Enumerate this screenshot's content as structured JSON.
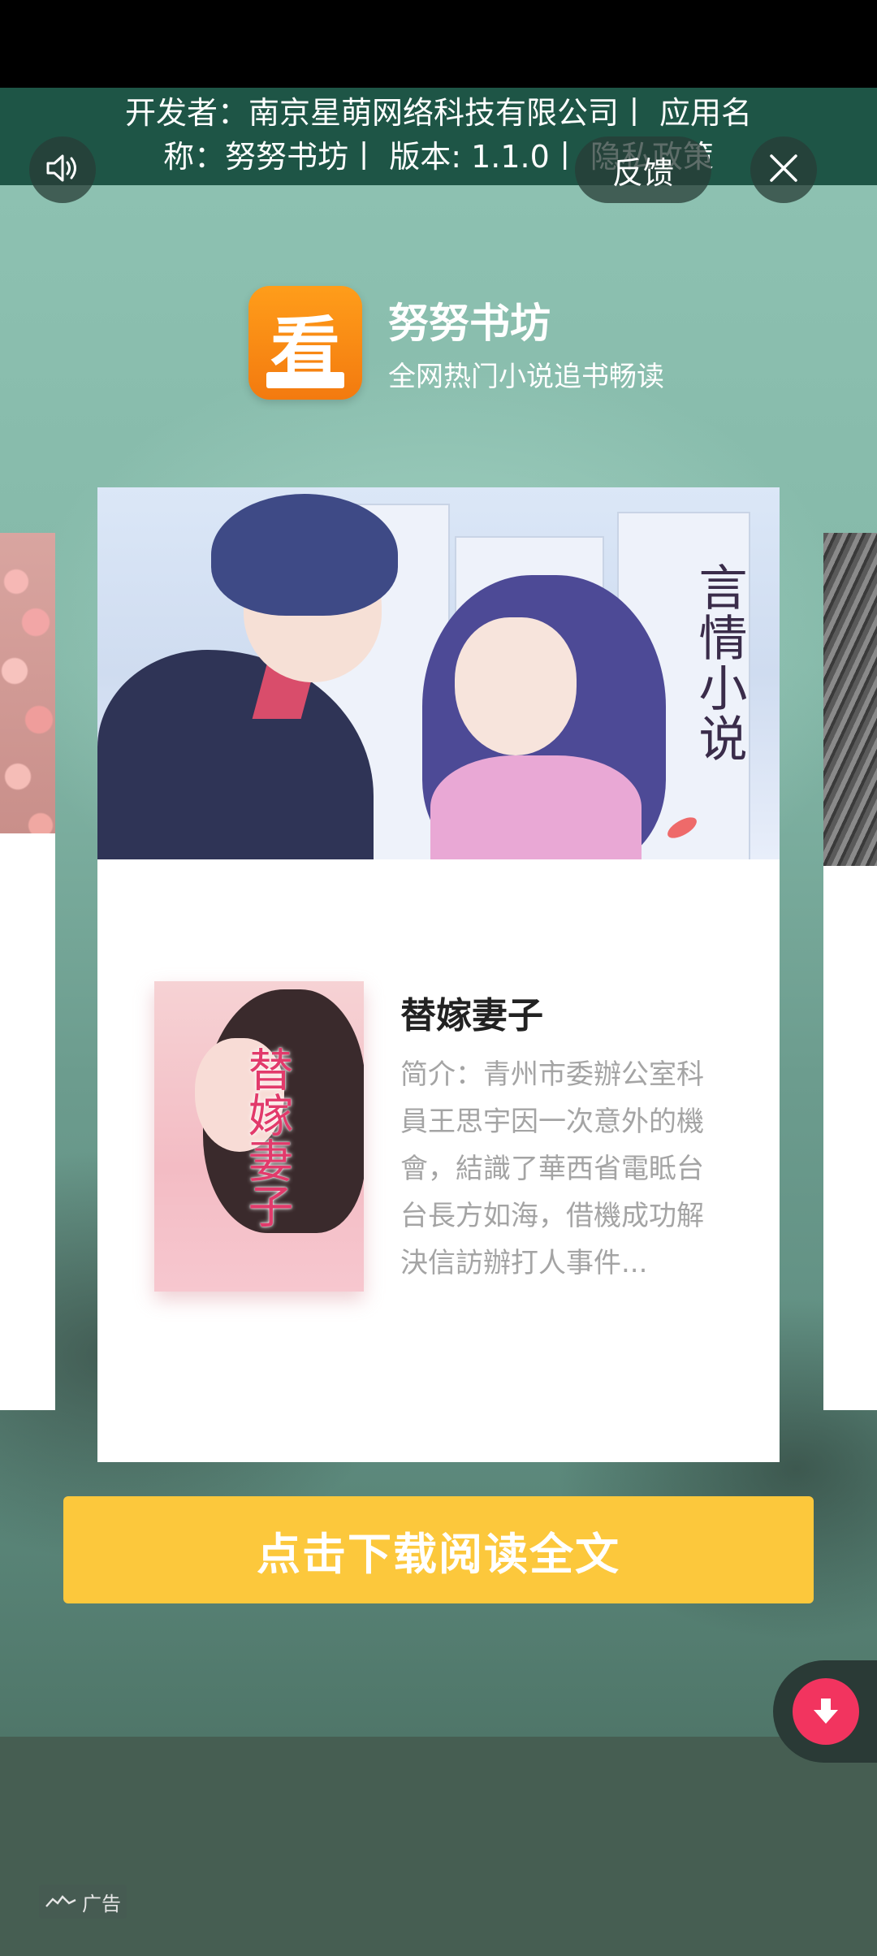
{
  "developer_info": {
    "text": "开发者：南京星萌网络科技有限公司丨 应用名称：努努书坊丨 版本: 1.1.0丨 隐私政策"
  },
  "controls": {
    "sound_icon": "speaker-icon",
    "feedback_label": "反馈",
    "close_icon": "close-icon"
  },
  "app": {
    "icon_glyph": "看",
    "name": "努努书坊",
    "tagline": "全网热门小说追书畅读"
  },
  "hero": {
    "label": "言情小说"
  },
  "book": {
    "cover_title": "替嫁妻子",
    "title": "替嫁妻子",
    "description": "简介：青州市委辦公室科員王思宇因一次意外的機會，結識了華西省電眡台台長方如海，借機成功解決信訪辦打人事件..."
  },
  "cta": {
    "label": "点击下载阅读全文"
  },
  "ad": {
    "label": "广告"
  },
  "colors": {
    "banner": "#1e5546",
    "cta": "#fcc83c",
    "download": "#f2345f"
  }
}
